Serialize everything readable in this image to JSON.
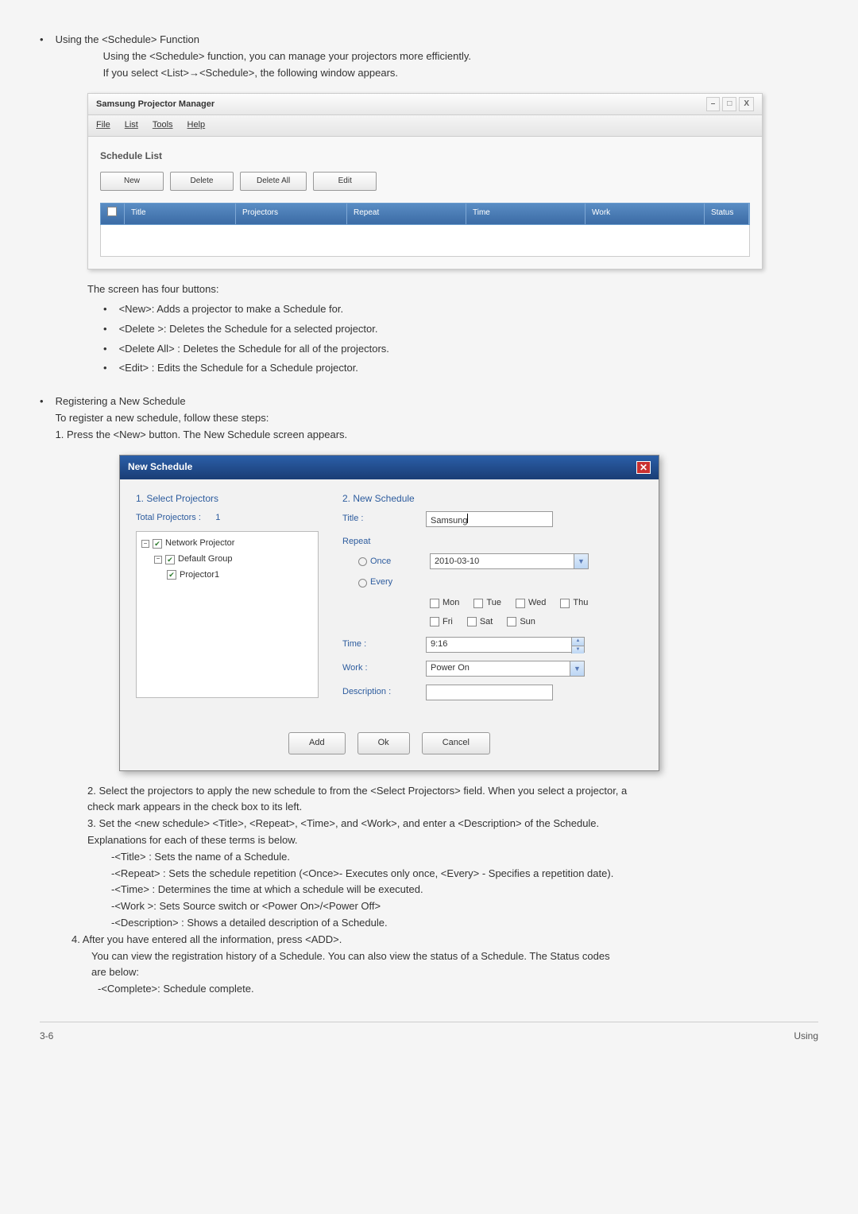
{
  "section1": {
    "title": "Using the <Schedule> Function",
    "line1": "Using the <Schedule> function, you can manage your projectors more efficiently.",
    "line2": "If you select <List>→<Schedule>, the following window appears."
  },
  "app_window": {
    "title": "Samsung Projector Manager",
    "menu": {
      "file": "File",
      "list": "List",
      "tools": "Tools",
      "help": "Help"
    },
    "panel_title": "Schedule List",
    "buttons": {
      "new": "New",
      "delete": "Delete",
      "delete_all": "Delete All",
      "edit": "Edit"
    },
    "headers": {
      "title": "Title",
      "projectors": "Projectors",
      "repeat": "Repeat",
      "time": "Time",
      "work": "Work",
      "status": "Status"
    }
  },
  "buttons_desc": {
    "intro": "The screen has four buttons:",
    "i1": "<New>: Adds a projector to make a Schedule for.",
    "i2": "<Delete >: Deletes the Schedule for a selected projector.",
    "i3": "<Delete All> : Deletes the Schedule for all of the projectors.",
    "i4": "<Edit> : Edits the Schedule for a Schedule projector."
  },
  "section2": {
    "title": "Registering a New Schedule",
    "line1": "To register a new schedule, follow these steps:",
    "line2": "1. Press the <New> button. The New Schedule screen appears."
  },
  "dialog": {
    "title": "New Schedule",
    "left_heading": "1. Select Projectors",
    "total_label": "Total Projectors :",
    "total_value": "1",
    "tree": {
      "n1": "Network Projector",
      "n2": "Default Group",
      "n3": "Projector1"
    },
    "right_heading": "2. New Schedule",
    "title_label": "Title :",
    "title_value": "Samsung",
    "repeat_label": "Repeat",
    "once": "Once",
    "every": "Every",
    "date": "2010-03-10",
    "days": {
      "mon": "Mon",
      "tue": "Tue",
      "wed": "Wed",
      "thu": "Thu",
      "fri": "Fri",
      "sat": "Sat",
      "sun": "Sun"
    },
    "time_label": "Time :",
    "time_value": "9:16",
    "work_label": "Work :",
    "work_value": "Power On",
    "desc_label": "Description :",
    "btn_add": "Add",
    "btn_ok": "Ok",
    "btn_cancel": "Cancel"
  },
  "post_dialog": {
    "p1a": "2. Select the projectors to apply the new schedule to from the <Select Projectors> field. When you select a projector, a",
    "p1b": "check mark appears in the check box to its left.",
    "p2a": "3. Set the <new schedule> <Title>, <Repeat>, <Time>, and <Work>, and enter a <Description> of the Schedule.",
    "p2b": "Explanations for each of these terms is below.",
    "t1": "-<Title> : Sets the name of a Schedule.",
    "t2": "-<Repeat> : Sets the schedule repetition (<Once>- Executes only once, <Every> - Specifies a repetition date).",
    "t3": "-<Time> : Determines the time at which a schedule will be executed.",
    "t4": "-<Work >: Sets Source switch or <Power On>/<Power Off>",
    "t5": "-<Description> : Shows a detailed description of a Schedule.",
    "p3": "4. After you have entered all the information, press <ADD>.",
    "p4a": "You can view the registration history of a Schedule. You can also view the status of a Schedule. The Status codes",
    "p4b": "are below:",
    "s1": "-<Complete>: Schedule complete."
  },
  "footer": {
    "left": "3-6",
    "right": "Using"
  }
}
